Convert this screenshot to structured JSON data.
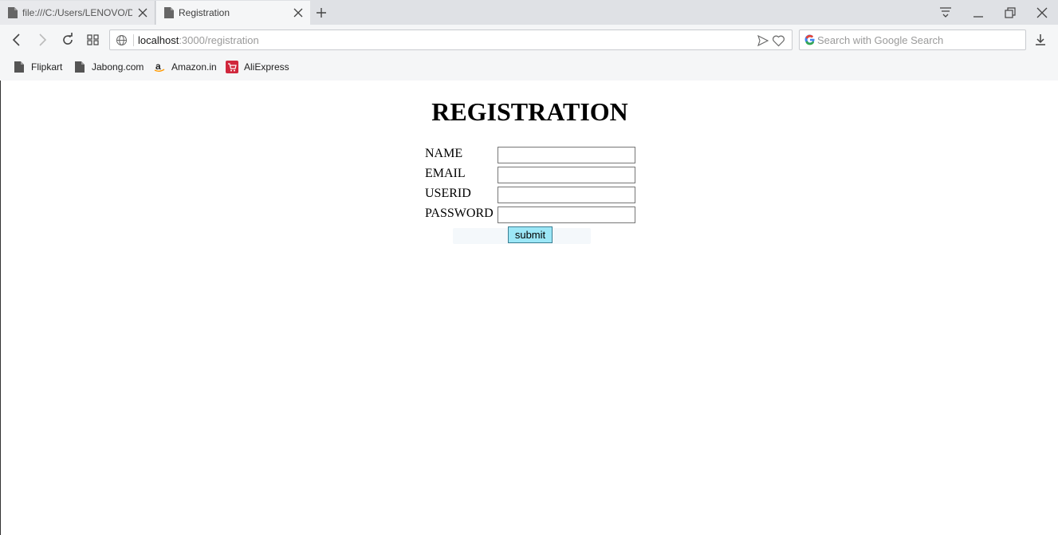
{
  "browser": {
    "tabs": [
      {
        "title": "file:///C:/Users/LENOVO/D"
      },
      {
        "title": "Registration"
      }
    ],
    "address_host": "localhost",
    "address_path": ":3000/registration",
    "search_placeholder": "Search with Google Search"
  },
  "bookmarks": [
    {
      "label": "Flipkart",
      "icon": "page-icon"
    },
    {
      "label": "Jabong.com",
      "icon": "page-icon"
    },
    {
      "label": "Amazon.in",
      "icon": "amazon-icon"
    },
    {
      "label": "AliExpress",
      "icon": "aliexpress-icon"
    }
  ],
  "page": {
    "heading": "REGISTRATION",
    "fields": [
      {
        "label": "NAME",
        "value": ""
      },
      {
        "label": "EMAIL",
        "value": ""
      },
      {
        "label": "USERID",
        "value": ""
      },
      {
        "label": "PASSWORD",
        "value": ""
      }
    ],
    "submit_label": "submit"
  },
  "colors": {
    "submit_bg": "#9ce7f7",
    "chrome_bg": "#f5f6f7",
    "tabstrip_bg": "#dfe1e5"
  }
}
